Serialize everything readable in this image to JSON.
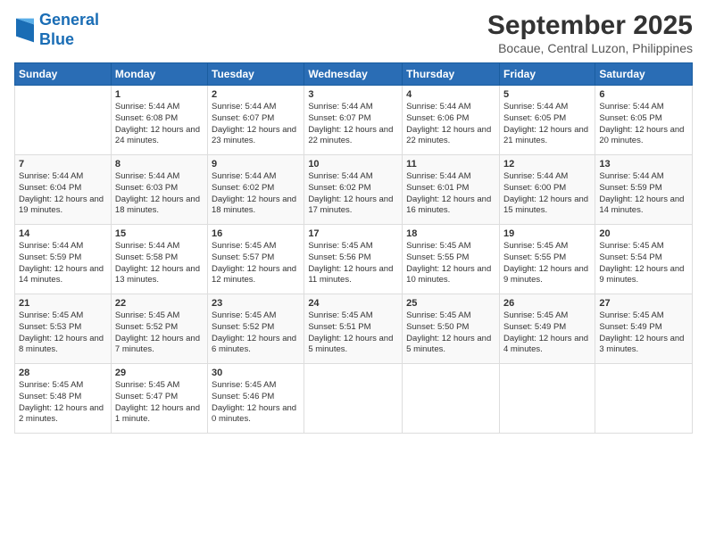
{
  "logo": {
    "line1": "General",
    "line2": "Blue"
  },
  "title": "September 2025",
  "subtitle": "Bocaue, Central Luzon, Philippines",
  "days_header": [
    "Sunday",
    "Monday",
    "Tuesday",
    "Wednesday",
    "Thursday",
    "Friday",
    "Saturday"
  ],
  "weeks": [
    [
      {
        "day": "",
        "sunrise": "",
        "sunset": "",
        "daylight": ""
      },
      {
        "day": "1",
        "sunrise": "Sunrise: 5:44 AM",
        "sunset": "Sunset: 6:08 PM",
        "daylight": "Daylight: 12 hours and 24 minutes."
      },
      {
        "day": "2",
        "sunrise": "Sunrise: 5:44 AM",
        "sunset": "Sunset: 6:07 PM",
        "daylight": "Daylight: 12 hours and 23 minutes."
      },
      {
        "day": "3",
        "sunrise": "Sunrise: 5:44 AM",
        "sunset": "Sunset: 6:07 PM",
        "daylight": "Daylight: 12 hours and 22 minutes."
      },
      {
        "day": "4",
        "sunrise": "Sunrise: 5:44 AM",
        "sunset": "Sunset: 6:06 PM",
        "daylight": "Daylight: 12 hours and 22 minutes."
      },
      {
        "day": "5",
        "sunrise": "Sunrise: 5:44 AM",
        "sunset": "Sunset: 6:05 PM",
        "daylight": "Daylight: 12 hours and 21 minutes."
      },
      {
        "day": "6",
        "sunrise": "Sunrise: 5:44 AM",
        "sunset": "Sunset: 6:05 PM",
        "daylight": "Daylight: 12 hours and 20 minutes."
      }
    ],
    [
      {
        "day": "7",
        "sunrise": "Sunrise: 5:44 AM",
        "sunset": "Sunset: 6:04 PM",
        "daylight": "Daylight: 12 hours and 19 minutes."
      },
      {
        "day": "8",
        "sunrise": "Sunrise: 5:44 AM",
        "sunset": "Sunset: 6:03 PM",
        "daylight": "Daylight: 12 hours and 18 minutes."
      },
      {
        "day": "9",
        "sunrise": "Sunrise: 5:44 AM",
        "sunset": "Sunset: 6:02 PM",
        "daylight": "Daylight: 12 hours and 18 minutes."
      },
      {
        "day": "10",
        "sunrise": "Sunrise: 5:44 AM",
        "sunset": "Sunset: 6:02 PM",
        "daylight": "Daylight: 12 hours and 17 minutes."
      },
      {
        "day": "11",
        "sunrise": "Sunrise: 5:44 AM",
        "sunset": "Sunset: 6:01 PM",
        "daylight": "Daylight: 12 hours and 16 minutes."
      },
      {
        "day": "12",
        "sunrise": "Sunrise: 5:44 AM",
        "sunset": "Sunset: 6:00 PM",
        "daylight": "Daylight: 12 hours and 15 minutes."
      },
      {
        "day": "13",
        "sunrise": "Sunrise: 5:44 AM",
        "sunset": "Sunset: 5:59 PM",
        "daylight": "Daylight: 12 hours and 14 minutes."
      }
    ],
    [
      {
        "day": "14",
        "sunrise": "Sunrise: 5:44 AM",
        "sunset": "Sunset: 5:59 PM",
        "daylight": "Daylight: 12 hours and 14 minutes."
      },
      {
        "day": "15",
        "sunrise": "Sunrise: 5:44 AM",
        "sunset": "Sunset: 5:58 PM",
        "daylight": "Daylight: 12 hours and 13 minutes."
      },
      {
        "day": "16",
        "sunrise": "Sunrise: 5:45 AM",
        "sunset": "Sunset: 5:57 PM",
        "daylight": "Daylight: 12 hours and 12 minutes."
      },
      {
        "day": "17",
        "sunrise": "Sunrise: 5:45 AM",
        "sunset": "Sunset: 5:56 PM",
        "daylight": "Daylight: 12 hours and 11 minutes."
      },
      {
        "day": "18",
        "sunrise": "Sunrise: 5:45 AM",
        "sunset": "Sunset: 5:55 PM",
        "daylight": "Daylight: 12 hours and 10 minutes."
      },
      {
        "day": "19",
        "sunrise": "Sunrise: 5:45 AM",
        "sunset": "Sunset: 5:55 PM",
        "daylight": "Daylight: 12 hours and 9 minutes."
      },
      {
        "day": "20",
        "sunrise": "Sunrise: 5:45 AM",
        "sunset": "Sunset: 5:54 PM",
        "daylight": "Daylight: 12 hours and 9 minutes."
      }
    ],
    [
      {
        "day": "21",
        "sunrise": "Sunrise: 5:45 AM",
        "sunset": "Sunset: 5:53 PM",
        "daylight": "Daylight: 12 hours and 8 minutes."
      },
      {
        "day": "22",
        "sunrise": "Sunrise: 5:45 AM",
        "sunset": "Sunset: 5:52 PM",
        "daylight": "Daylight: 12 hours and 7 minutes."
      },
      {
        "day": "23",
        "sunrise": "Sunrise: 5:45 AM",
        "sunset": "Sunset: 5:52 PM",
        "daylight": "Daylight: 12 hours and 6 minutes."
      },
      {
        "day": "24",
        "sunrise": "Sunrise: 5:45 AM",
        "sunset": "Sunset: 5:51 PM",
        "daylight": "Daylight: 12 hours and 5 minutes."
      },
      {
        "day": "25",
        "sunrise": "Sunrise: 5:45 AM",
        "sunset": "Sunset: 5:50 PM",
        "daylight": "Daylight: 12 hours and 5 minutes."
      },
      {
        "day": "26",
        "sunrise": "Sunrise: 5:45 AM",
        "sunset": "Sunset: 5:49 PM",
        "daylight": "Daylight: 12 hours and 4 minutes."
      },
      {
        "day": "27",
        "sunrise": "Sunrise: 5:45 AM",
        "sunset": "Sunset: 5:49 PM",
        "daylight": "Daylight: 12 hours and 3 minutes."
      }
    ],
    [
      {
        "day": "28",
        "sunrise": "Sunrise: 5:45 AM",
        "sunset": "Sunset: 5:48 PM",
        "daylight": "Daylight: 12 hours and 2 minutes."
      },
      {
        "day": "29",
        "sunrise": "Sunrise: 5:45 AM",
        "sunset": "Sunset: 5:47 PM",
        "daylight": "Daylight: 12 hours and 1 minute."
      },
      {
        "day": "30",
        "sunrise": "Sunrise: 5:45 AM",
        "sunset": "Sunset: 5:46 PM",
        "daylight": "Daylight: 12 hours and 0 minutes."
      },
      {
        "day": "",
        "sunrise": "",
        "sunset": "",
        "daylight": ""
      },
      {
        "day": "",
        "sunrise": "",
        "sunset": "",
        "daylight": ""
      },
      {
        "day": "",
        "sunrise": "",
        "sunset": "",
        "daylight": ""
      },
      {
        "day": "",
        "sunrise": "",
        "sunset": "",
        "daylight": ""
      }
    ]
  ]
}
